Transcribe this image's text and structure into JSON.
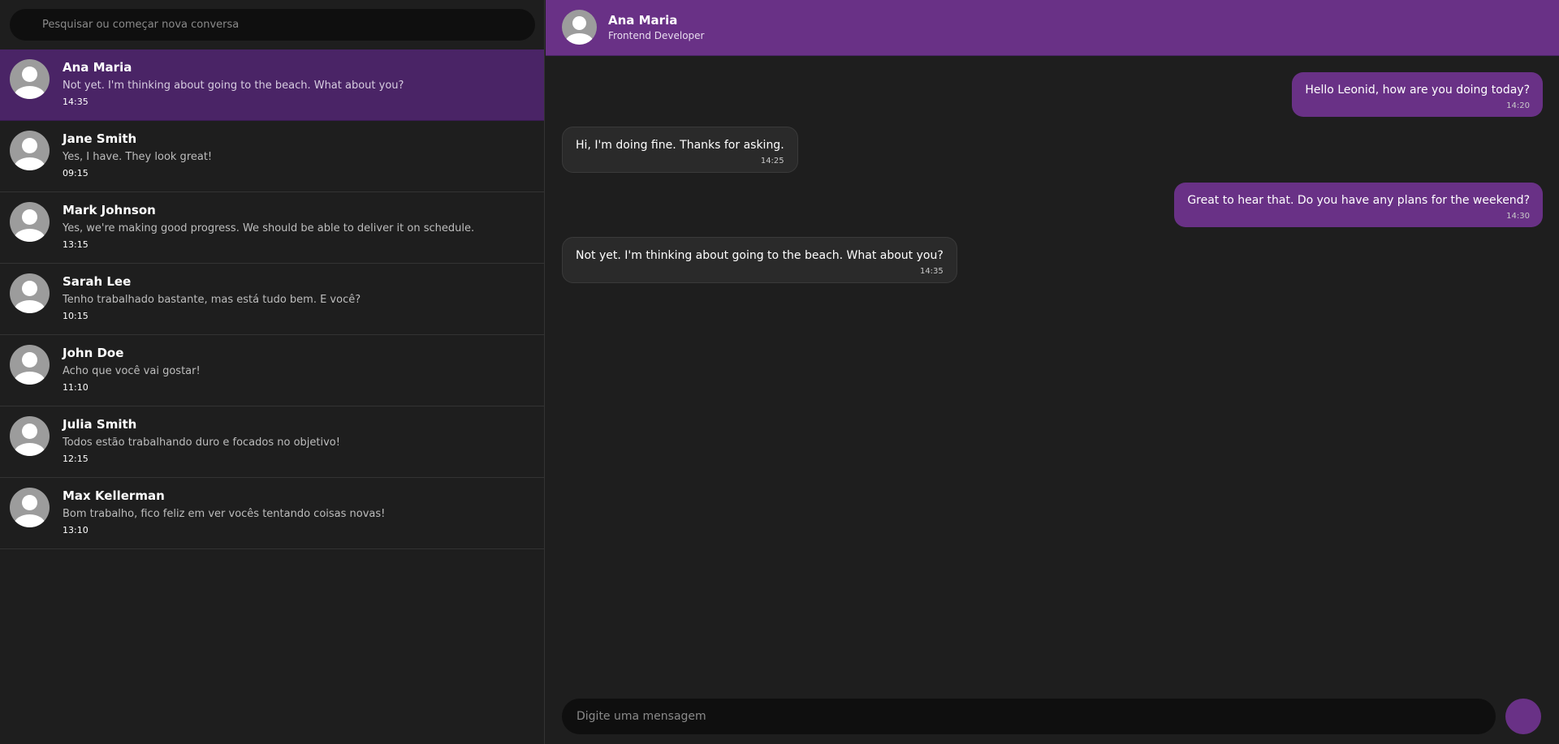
{
  "search": {
    "placeholder": "Pesquisar ou começar nova conversa"
  },
  "conversations": [
    {
      "name": "Ana Maria",
      "last": "Not yet. I'm thinking about going to the beach. What about you?",
      "time": "14:35",
      "active": true
    },
    {
      "name": "Jane Smith",
      "last": "Yes, I have. They look great!",
      "time": "09:15"
    },
    {
      "name": "Mark Johnson",
      "last": "Yes, we're making good progress. We should be able to deliver it on schedule.",
      "time": "13:15"
    },
    {
      "name": "Sarah Lee",
      "last": "Tenho trabalhado bastante, mas está tudo bem. E você?",
      "time": "10:15"
    },
    {
      "name": "John Doe",
      "last": "Acho que você vai gostar!",
      "time": "11:10"
    },
    {
      "name": "Julia Smith",
      "last": "Todos estão trabalhando duro e focados no objetivo!",
      "time": "12:15"
    },
    {
      "name": "Max Kellerman",
      "last": "Bom trabalho, fico feliz em ver vocês tentando coisas novas!",
      "time": "13:10"
    }
  ],
  "chat": {
    "header": {
      "name": "Ana Maria",
      "subtitle": "Frontend Developer"
    },
    "messages": [
      {
        "direction": "sent",
        "text": "Hello Leonid, how are you doing today?",
        "time": "14:20"
      },
      {
        "direction": "recv",
        "text": "Hi, I'm doing fine. Thanks for asking.",
        "time": "14:25"
      },
      {
        "direction": "sent",
        "text": "Great to hear that. Do you have any plans for the weekend?",
        "time": "14:30"
      },
      {
        "direction": "recv",
        "text": "Not yet. I'm thinking about going to the beach. What about you?",
        "time": "14:35"
      }
    ],
    "composer": {
      "placeholder": "Digite uma mensagem"
    }
  },
  "colors": {
    "accent": "#693186",
    "active_item": "#4a2466",
    "background": "#1e1e1e"
  },
  "icons": {
    "avatar": "user-avatar-icon"
  }
}
